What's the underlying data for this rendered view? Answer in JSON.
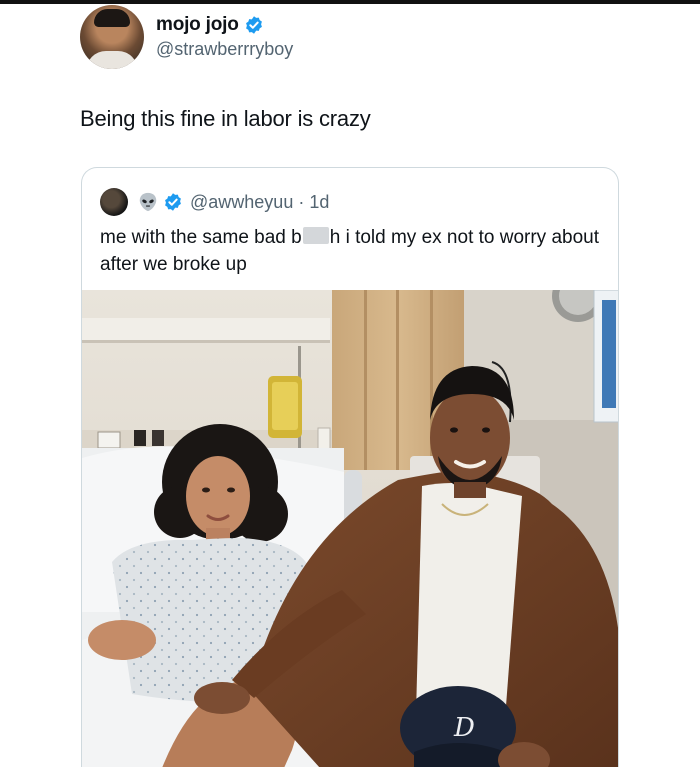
{
  "tweet": {
    "display_name": "mojo jojo",
    "handle": "@strawberrryboy",
    "text": "Being this fine in labor is crazy"
  },
  "quoted_tweet": {
    "handle_time": "@awwheyuu · 1d",
    "text_before": "me with the same bad b",
    "text_after": "h i told my ex not to worry about after we broke up"
  },
  "icons": {
    "verified": "verified-badge-icon",
    "alien": "alien-emoji-icon"
  },
  "colors": {
    "verified_blue": "#1d9bf0",
    "handle_gray": "#536471",
    "border": "#cfd9de"
  }
}
